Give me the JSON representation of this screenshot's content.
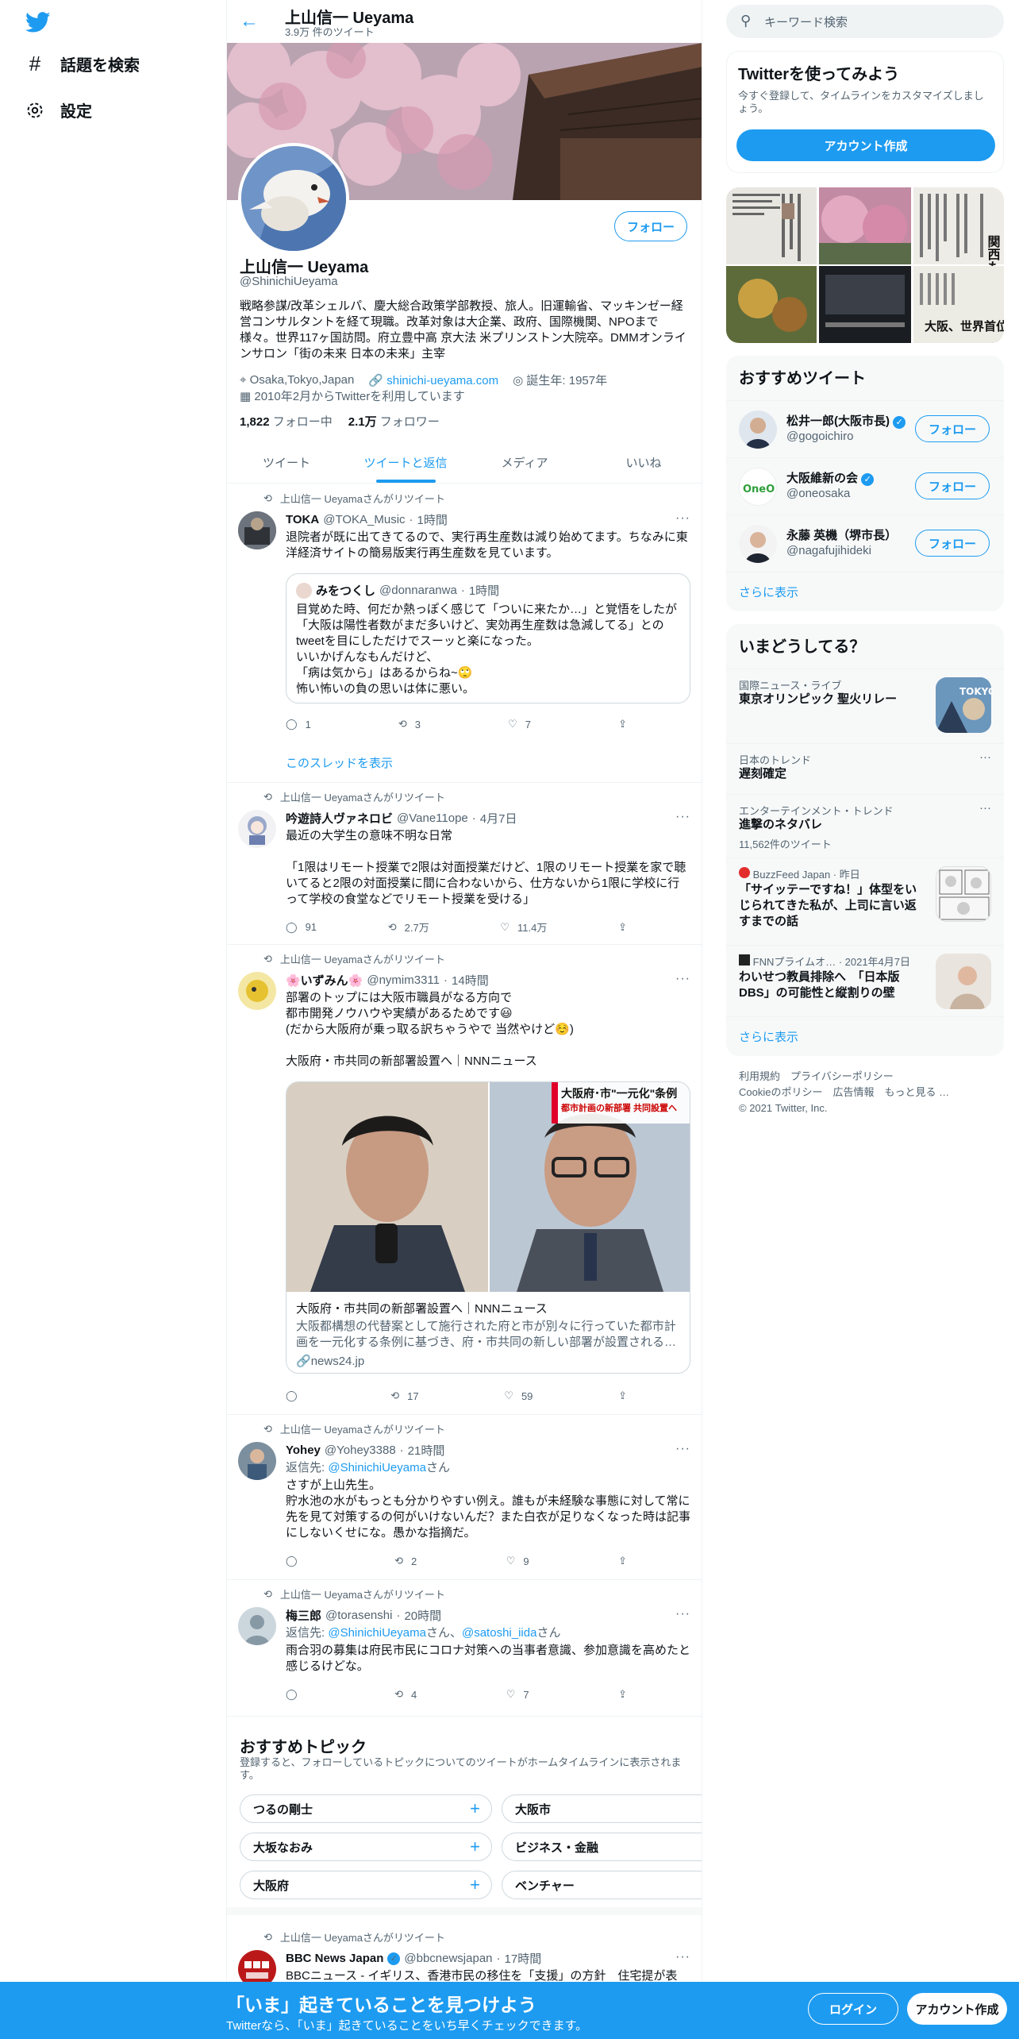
{
  "nav": {
    "explore": "話題を検索",
    "settings": "設定"
  },
  "header": {
    "name": "上山信一 Ueyama",
    "tweet_count": "3.9万 件のツイート"
  },
  "profile": {
    "name": "上山信一 Ueyama",
    "handle": "@ShinichiUeyama",
    "follow": "フォロー",
    "bio": "戦略参謀/改革シェルパ、慶大総合政策学部教授、旅人。旧運輸省、マッキンゼー経営コンサルタントを経て現職。改革対象は大企業、政府、国際機関、NPOまで様々。世界117ヶ国訪問。府立豊中高 京大法 米プリンストン大院卒。DMMオンラインサロン「街の未来 日本の未来」主宰",
    "location": "Osaka,Tokyo,Japan",
    "website": "shinichi-ueyama.com",
    "birth": "誕生年: 1957年",
    "joined": "2010年2月からTwitterを利用しています",
    "following_count": "1,822",
    "following_label": "フォロー中",
    "followers_count": "2.1万",
    "followers_label": "フォロワー"
  },
  "tabs": [
    "ツイート",
    "ツイートと返信",
    "メディア",
    "いいね"
  ],
  "tweets": [
    {
      "rt": "上山信一 Ueyamaさんがリツイート",
      "name": "TOKA",
      "handle": "@TOKA_Music",
      "time": "1時間",
      "text": "退院者が既に出てきてるので、実行再生産数は減り始めてます。ちなみに東洋経済サイトの簡易版実行再生産数を見ています。",
      "quote": {
        "name": "みをつくし",
        "handle": "@donnaranwa",
        "time": "1時間",
        "text": "目覚めた時、何だか熱っぽく感じて「ついに来たか…」と覚悟をしたが「大阪は陽性者数がまだ多いけど、実効再生産数は急減してる」とのtweetを目にしただけでスーッと楽になった。\nいいかげんなもんだけど、\n「病は気から」はあるからね~🙄\n怖い怖いの負の思いは体に悪い。"
      },
      "reply": "1",
      "retweet": "3",
      "like": "7",
      "thread": "このスレッドを表示"
    },
    {
      "rt": "上山信一 Ueyamaさんがリツイート",
      "name": "吟遊詩人ヴァネロビ",
      "handle": "@Vane11ope",
      "time": "4月7日",
      "text": "最近の大学生の意味不明な日常\n\n「1限はリモート授業で2限は対面授業だけど、1限のリモート授業を家で聴いてると2限の対面授業に間に合わないから、仕方ないから1限に学校に行って学校の食堂などでリモート授業を受ける」",
      "reply": "91",
      "retweet": "2.7万",
      "like": "11.4万"
    },
    {
      "rt": "上山信一 Ueyamaさんがリツイート",
      "name": "🌸いずみん🌸",
      "handle": "@nymim3311",
      "time": "14時間",
      "text": "部署のトップには大阪市職員がなる方向で\n都市開発ノウハウや実績があるためです😃\n(だから大阪府が乗っ取る訳ちゃうやで 当然やけど☺️)\n\n大阪府・市共同の新部署設置へ｜NNNニュース",
      "card": {
        "title": "大阪府・市共同の新部署設置へ｜NNNニュース",
        "desc": "大阪都構想の代替案として施行された府と市が別々に行っていた都市計画を一元化する条例に基づき、府・市共同の新しい部署が設置される…",
        "domain": "news24.jp",
        "overlay1": "大阪府･市\"一元化\"条例",
        "overlay2": "都市計画の新部署 共同設置へ"
      },
      "reply": "",
      "retweet": "17",
      "like": "59"
    },
    {
      "rt": "上山信一 Ueyamaさんがリツイート",
      "name": "Yohey",
      "handle": "@Yohey3388",
      "time": "21時間",
      "reply_to_label": "返信先: ",
      "reply_to": "@ShinichiUeyama",
      "reply_to_suffix": "さん",
      "text": "さすが上山先生。\n貯水池の水がもっとも分かりやすい例え。誰もが未経験な事態に対して常に先を見て対策するの何がいけないんだ？また白衣が足りなくなった時は記事にしないくせにな。愚かな指摘だ。",
      "reply": "",
      "retweet": "2",
      "like": "9"
    },
    {
      "rt": "上山信一 Ueyamaさんがリツイート",
      "name": "梅三郎",
      "handle": "@torasenshi",
      "time": "20時間",
      "reply_to_label": "返信先: ",
      "reply_to": "@ShinichiUeyama",
      "reply_to_mid": "さん、",
      "reply_to2": "@satoshi_iida",
      "reply_to_suffix": "さん",
      "text": "雨合羽の募集は府民市民にコロナ対策への当事者意識、参加意識を高めたと感じるけどな。",
      "reply": "",
      "retweet": "4",
      "like": "7"
    }
  ],
  "topics": {
    "title": "おすすめトピック",
    "desc": "登録すると、フォローしているトピックについてのツイートがホームタイムラインに表示されます。",
    "items": [
      "つるの剛士",
      "大阪市",
      "大坂なおみ",
      "ビジネス・金融",
      "大阪府",
      "ベンチャー"
    ]
  },
  "last_tweet": {
    "rt": "上山信一 Ueyamaさんがリツイート",
    "name": "BBC News Japan",
    "handle": "@bbcnewsjapan",
    "time": "17時間",
    "text": "BBCニュース - イギリス、香港市民の移住を「支援」の方針　住宅提が表"
  },
  "right": {
    "search_placeholder": "キーワード検索",
    "signup_title": "Twitterを使ってみよう",
    "signup_desc": "今すぐ登録して、タイムラインをカスタマイズしましょう。",
    "signup_button": "アカウント作成",
    "who_title": "おすすめツイート",
    "who": [
      {
        "name": "松井一郎(大阪市長)",
        "handle": "@gogoichiro",
        "follow": "フォロー"
      },
      {
        "name": "大阪維新の会",
        "handle": "@oneosaka",
        "follow": "フォロー"
      },
      {
        "name": "永藤 英機（堺市長）",
        "handle": "@nagafujihideki",
        "follow": "フォロー"
      }
    ],
    "show_more": "さらに表示",
    "trends_title": "いまどうしてる？",
    "trends": [
      {
        "meta": "国際ニュース・ライブ",
        "name": "東京オリンピック 聖火リレー",
        "thumb": "TOKYO"
      },
      {
        "meta": "日本のトレンド",
        "name": "遅刻確定"
      },
      {
        "meta": "エンターテインメント・トレンド",
        "name": "進撃のネタバレ",
        "count": "11,562件のツイート"
      },
      {
        "meta": "BuzzFeed Japan · 昨日",
        "name": "「サイッテーですね！」体型をいじられてきた私が、上司に言い返すまでの話"
      },
      {
        "meta": "FNNプライムオ… · 2021年4月7日",
        "name": "わいせつ教員排除へ　「日本版DBS」の可能性と縦割りの壁"
      }
    ],
    "media_text": [
      "大阪、世界首位続く",
      "関西も緊急事態宣言"
    ],
    "footer": [
      "利用規約",
      "プライバシーポリシー",
      "Cookieのポリシー",
      "広告情報",
      "もっと見る …",
      "© 2021 Twitter, Inc."
    ]
  },
  "bottom": {
    "title": "「いま」起きていることを見つけよう",
    "sub": "Twitterなら、「いま」起きていることをいち早くチェックできます。",
    "login": "ログイン",
    "signup": "アカウント作成"
  }
}
